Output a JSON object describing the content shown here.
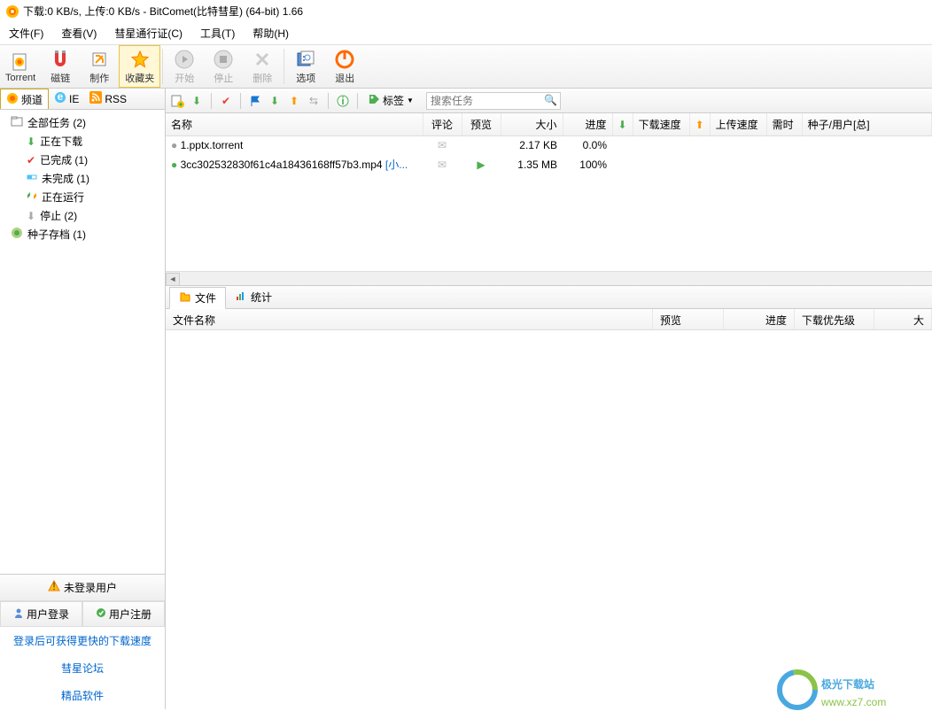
{
  "title": "下载:0 KB/s, 上传:0 KB/s - BitComet(比特彗星) (64-bit) 1.66",
  "menu": {
    "file": "文件(F)",
    "view": "查看(V)",
    "pass": "彗星通行证(C)",
    "tools": "工具(T)",
    "help": "帮助(H)"
  },
  "toolbar": {
    "torrent": "Torrent",
    "magnet": "磁链",
    "make": "制作",
    "favorites": "收藏夹",
    "start": "开始",
    "stop": "停止",
    "delete": "删除",
    "options": "选项",
    "exit": "退出"
  },
  "sideTabs": {
    "channel": "频道",
    "ie": "IE",
    "rss": "RSS"
  },
  "tree": {
    "allTasks": "全部任务 (2)",
    "downloading": "正在下载",
    "completed": "已完成 (1)",
    "incomplete": "未完成 (1)",
    "running": "正在运行",
    "stopped": "停止 (2)",
    "torrentArchive": "种子存档 (1)"
  },
  "userBox": {
    "notLoggedIn": "未登录用户",
    "login": "用户登录",
    "register": "用户注册",
    "tip": "登录后可获得更快的下载速度",
    "forum": "彗星论坛",
    "software": "精品软件"
  },
  "toolRow": {
    "label": "标签",
    "searchPlaceholder": "搜索任务"
  },
  "columns": {
    "name": "名称",
    "comment": "评论",
    "preview": "预览",
    "size": "大小",
    "progress": "进度",
    "dlSpeed": "下载速度",
    "ulSpeed": "上传速度",
    "time": "需时",
    "seeds": "种子/用户[总]"
  },
  "tasks": [
    {
      "name": "1.pptx.torrent",
      "size": "2.17 KB",
      "progress": "0.0%",
      "status": "gray"
    },
    {
      "name": "3cc302532830f61c4a18436168ff57b3.mp4",
      "link": "[小...",
      "size": "1.35 MB",
      "progress": "100%",
      "status": "green",
      "preview": true
    }
  ],
  "detailTabs": {
    "file": "文件",
    "stats": "统计"
  },
  "detailCols": {
    "fileName": "文件名称",
    "preview": "预览",
    "progress": "进度",
    "priority": "下载优先级",
    "size": "大"
  },
  "watermark": {
    "line1": "极光下载站",
    "line2": "www.xz7.com"
  }
}
